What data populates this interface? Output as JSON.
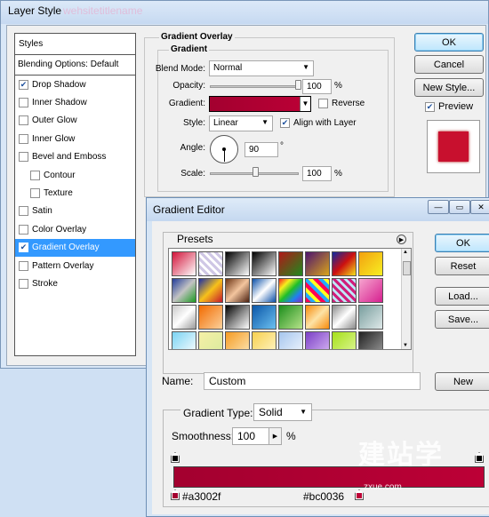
{
  "layer_style": {
    "title": "Layer Style",
    "title_ghost": "wehsitetitlename",
    "styles_header": "Styles",
    "blending_options": "Blending Options: Default",
    "items": [
      {
        "label": "Drop Shadow",
        "checked": true,
        "indent": false,
        "selected": false
      },
      {
        "label": "Inner Shadow",
        "checked": false,
        "indent": false,
        "selected": false
      },
      {
        "label": "Outer Glow",
        "checked": false,
        "indent": false,
        "selected": false
      },
      {
        "label": "Inner Glow",
        "checked": false,
        "indent": false,
        "selected": false
      },
      {
        "label": "Bevel and Emboss",
        "checked": false,
        "indent": false,
        "selected": false
      },
      {
        "label": "Contour",
        "checked": false,
        "indent": true,
        "selected": false
      },
      {
        "label": "Texture",
        "checked": false,
        "indent": true,
        "selected": false
      },
      {
        "label": "Satin",
        "checked": false,
        "indent": false,
        "selected": false
      },
      {
        "label": "Color Overlay",
        "checked": false,
        "indent": false,
        "selected": false
      },
      {
        "label": "Gradient Overlay",
        "checked": true,
        "indent": false,
        "selected": true
      },
      {
        "label": "Pattern Overlay",
        "checked": false,
        "indent": false,
        "selected": false
      },
      {
        "label": "Stroke",
        "checked": false,
        "indent": false,
        "selected": false
      }
    ],
    "panel": {
      "group_title": "Gradient Overlay",
      "subgroup_title": "Gradient",
      "blend_mode_label": "Blend Mode:",
      "blend_mode_value": "Normal",
      "opacity_label": "Opacity:",
      "opacity_value": "100",
      "opacity_unit": "%",
      "opacity_level": 1.0,
      "gradient_label": "Gradient:",
      "reverse_label": "Reverse",
      "reverse_checked": false,
      "style_label": "Style:",
      "style_value": "Linear",
      "align_label": "Align with Layer",
      "align_checked": true,
      "angle_label": "Angle:",
      "angle_value": "90",
      "angle_unit": "°",
      "scale_label": "Scale:",
      "scale_value": "100",
      "scale_unit": "%",
      "scale_level": 0.5
    },
    "buttons": {
      "ok": "OK",
      "cancel": "Cancel",
      "new_style": "New Style...",
      "preview_label": "Preview",
      "preview_checked": true
    }
  },
  "gradient_editor": {
    "title": "Gradient Editor",
    "presets_label": "Presets",
    "buttons": {
      "ok": "OK",
      "reset": "Reset",
      "load": "Load...",
      "save": "Save...",
      "new": "New"
    },
    "name_label": "Name:",
    "name_value": "Custom",
    "gradient_type_label": "Gradient Type:",
    "gradient_type_value": "Solid",
    "smoothness_label": "Smoothness:",
    "smoothness_value": "100",
    "smoothness_unit": "%",
    "start_color": "#a3002f",
    "end_color": "#bc0036",
    "start_color_label": "#a3002f",
    "end_color_label": "#bc0036",
    "presets": [
      "linear-gradient(135deg,#d2143a,#fff)",
      "repeating-linear-gradient(45deg,#cfc7e5 0 3px,#ffffff 3px 6px)",
      "linear-gradient(135deg,#000,#fff)",
      "linear-gradient(135deg,#000,#fff)",
      "linear-gradient(135deg,#b01818,#1e8a1e)",
      "linear-gradient(135deg,#4d1470,#d9a41a)",
      "linear-gradient(135deg,#0d2aa3,#cc1010,#f3e21a)",
      "linear-gradient(135deg,#f3a110,#f7ef22)",
      "linear-gradient(135deg,#233c9a,#c3c3c3,#1c9a22)",
      "linear-gradient(135deg,#1b2fa5,#f7c11a,#c5182c)",
      "linear-gradient(135deg,#6d3515,#f3c59e,#4b2010)",
      "linear-gradient(135deg,#0a4fa8,#fff,#0a4fa8)",
      "linear-gradient(135deg,#fa2020,#f7ef1e,#1ebf28,#2080f0,#8a2ac2)",
      "repeating-linear-gradient(45deg,#f05 0 4px,#2af 4px 8px,#ff2 8px 12px)",
      "repeating-linear-gradient(45deg,#d01d7a 0 3px,#bfe7f7 3px 6px)",
      "linear-gradient(135deg,#f6a5cf,#d6208f)",
      "linear-gradient(135deg,#c8c8c8,#fff,#9a9a9a)",
      "linear-gradient(135deg,#f26a00,#fbd19b)",
      "linear-gradient(135deg,#000,#888,#fff)",
      "linear-gradient(135deg,#0a56a8,#6cc0f0)",
      "linear-gradient(135deg,#1c8e1c,#b7e38a)",
      "linear-gradient(135deg,#f78a0a,#fde3a6,#f78a0a)",
      "linear-gradient(135deg,#8a8a8a,#fff,#8a8a8a)",
      "linear-gradient(135deg,#789e9e,#dfe9e9)",
      "linear-gradient(135deg,#7ad3f3,#fff)",
      "linear-gradient(135deg,#f6f0a6,#d9eb9e)",
      "linear-gradient(135deg,#f59b23,#fde7b6)",
      "linear-gradient(135deg,#f7d050,#fff6c8)",
      "linear-gradient(135deg,#a6c6ee,#f1f6fd)",
      "linear-gradient(135deg,#7b3fc6,#d9b8f5)",
      "linear-gradient(135deg,#a6e01a,#dff79a)",
      "linear-gradient(135deg,#222,#9a9a9a)"
    ]
  },
  "watermark": {
    "text": "建站学",
    "sub": "zxue.com"
  }
}
